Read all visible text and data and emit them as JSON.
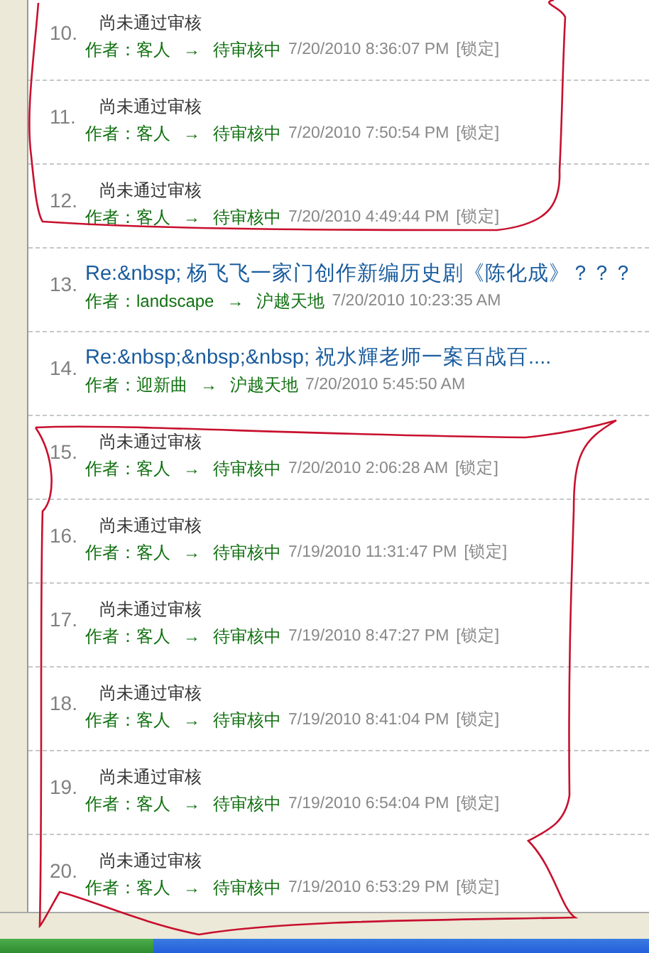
{
  "posts": [
    {
      "number": "10.",
      "kind": "pending",
      "title": "尚未通过审核",
      "author": "作者：客人",
      "arrow": "→",
      "forum": "待审核中",
      "time": "7/20/2010 8:36:07 PM",
      "lock": "[锁定]"
    },
    {
      "number": "11.",
      "kind": "pending",
      "title": "尚未通过审核",
      "author": "作者：客人",
      "arrow": "→",
      "forum": "待审核中",
      "time": "7/20/2010 7:50:54 PM",
      "lock": "[锁定]"
    },
    {
      "number": "12.",
      "kind": "pending",
      "title": "尚未通过审核",
      "author": "作者：客人",
      "arrow": "→",
      "forum": "待审核中",
      "time": "7/20/2010 4:49:44 PM",
      "lock": "[锁定]"
    },
    {
      "number": "13.",
      "kind": "link",
      "title": "Re:&nbsp; 杨飞飞一家门创作新编历史剧《陈化成》？？？",
      "author": "作者：landscape",
      "arrow": "→",
      "forum": "沪越天地",
      "time": "7/20/2010 10:23:35 AM"
    },
    {
      "number": "14.",
      "kind": "link",
      "title": "Re:&nbsp;&nbsp;&nbsp; 祝水輝老师一案百战百....",
      "author": "作者：迎新曲",
      "arrow": "→",
      "forum": "沪越天地",
      "time": "7/20/2010 5:45:50 AM"
    },
    {
      "number": "15.",
      "kind": "pending",
      "title": "尚未通过审核",
      "author": "作者：客人",
      "arrow": "→",
      "forum": "待审核中",
      "time": "7/20/2010 2:06:28 AM",
      "lock": "[锁定]"
    },
    {
      "number": "16.",
      "kind": "pending",
      "title": "尚未通过审核",
      "author": "作者：客人",
      "arrow": "→",
      "forum": "待审核中",
      "time": "7/19/2010 11:31:47 PM",
      "lock": "[锁定]"
    },
    {
      "number": "17.",
      "kind": "pending",
      "title": "尚未通过审核",
      "author": "作者：客人",
      "arrow": "→",
      "forum": "待审核中",
      "time": "7/19/2010 8:47:27 PM",
      "lock": "[锁定]"
    },
    {
      "number": "18.",
      "kind": "pending",
      "title": "尚未通过审核",
      "author": "作者：客人",
      "arrow": "→",
      "forum": "待审核中",
      "time": "7/19/2010 8:41:04 PM",
      "lock": "[锁定]"
    },
    {
      "number": "19.",
      "kind": "pending",
      "title": "尚未通过审核",
      "author": "作者：客人",
      "arrow": "→",
      "forum": "待审核中",
      "time": "7/19/2010 6:54:04 PM",
      "lock": "[锁定]"
    },
    {
      "number": "20.",
      "kind": "pending",
      "title": "尚未通过审核",
      "author": "作者：客人",
      "arrow": "→",
      "forum": "待审核中",
      "time": "7/19/2010 6:53:29 PM",
      "lock": "[锁定]"
    }
  ]
}
